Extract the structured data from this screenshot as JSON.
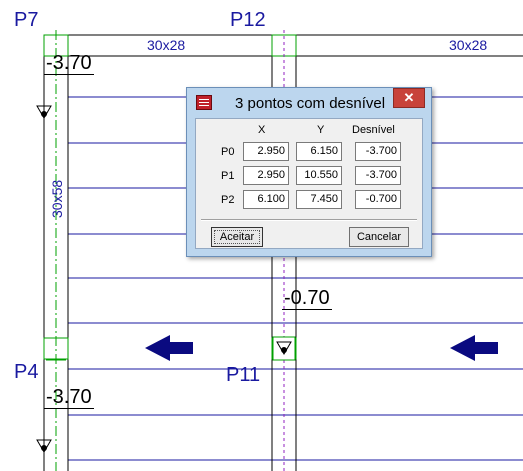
{
  "drawing": {
    "pillars": [
      {
        "name": "P7"
      },
      {
        "name": "P12"
      },
      {
        "name": "P4"
      },
      {
        "name": "P11"
      }
    ],
    "beams": [
      "30x28",
      "30x28"
    ],
    "vertical_beam": "30x58",
    "levels": [
      "-3.70",
      "-0.70",
      "-3.70"
    ]
  },
  "dialog": {
    "title": "3 pontos com desnível",
    "close_symbol": "✕",
    "columns": [
      "X",
      "Y",
      "Desnível"
    ],
    "rows": [
      {
        "label": "P0",
        "x": "2.950",
        "y": "6.150",
        "d": "-3.700"
      },
      {
        "label": "P1",
        "x": "2.950",
        "y": "10.550",
        "d": "-3.700"
      },
      {
        "label": "P2",
        "x": "6.100",
        "y": "7.450",
        "d": "-0.700"
      }
    ],
    "ok_label": "Aceitar",
    "cancel_label": "Cancelar",
    "icon": "app-icon"
  },
  "colors": {
    "drawing_blue": "#1a1aa0",
    "dialog_frame": "#bcd6ee",
    "close_red": "#c8423a",
    "arrow_navy": "#0a0a80",
    "guide_green": "#00a000"
  }
}
